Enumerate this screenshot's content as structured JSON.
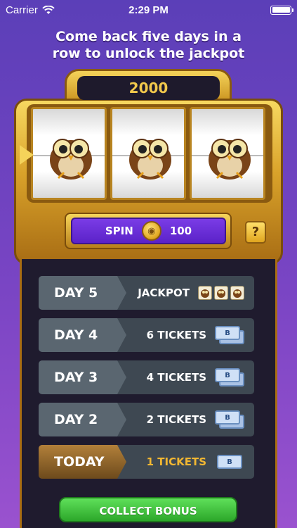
{
  "status_bar": {
    "carrier": "Carrier",
    "time": "2:29 PM"
  },
  "headline": [
    "Come back five days in a",
    "row to unlock the jackpot"
  ],
  "slot_machine": {
    "jackpot_value": "2000",
    "reels": [
      "owl-icon",
      "owl-icon",
      "owl-icon"
    ],
    "spin_label": "SPIN",
    "spin_cost": "100",
    "help_label": "?"
  },
  "days": [
    {
      "label": "DAY 5",
      "reward": "JACKPOT",
      "icon": "owl-tiles-icon",
      "today": false
    },
    {
      "label": "DAY 4",
      "reward": "6 TICKETS",
      "icon": "tickets-icon",
      "today": false
    },
    {
      "label": "DAY 3",
      "reward": "4 TICKETS",
      "icon": "tickets-icon",
      "today": false
    },
    {
      "label": "DAY 2",
      "reward": "2 TICKETS",
      "icon": "tickets-icon",
      "today": false
    },
    {
      "label": "TODAY",
      "reward": "1 TICKETS",
      "icon": "ticket-icon",
      "today": true
    }
  ],
  "ticket_letter": "B",
  "collect_label": "COLLECT BONUS",
  "colors": {
    "background": "#6a42c0",
    "gold": "#e0a51e",
    "spin_purple": "#6a2ed8",
    "collect_green": "#3cc23a",
    "today_reward": "#f2b732"
  }
}
